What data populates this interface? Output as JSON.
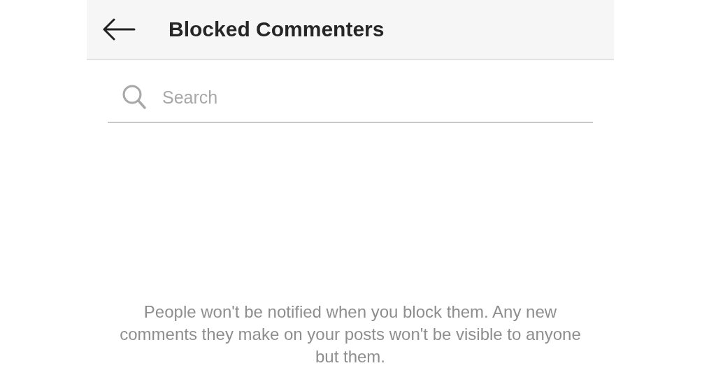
{
  "header": {
    "title": "Blocked Commenters"
  },
  "search": {
    "placeholder": "Search"
  },
  "message": "People won't be notified when you block them. Any new comments they make on your posts won't be visible to anyone but them."
}
